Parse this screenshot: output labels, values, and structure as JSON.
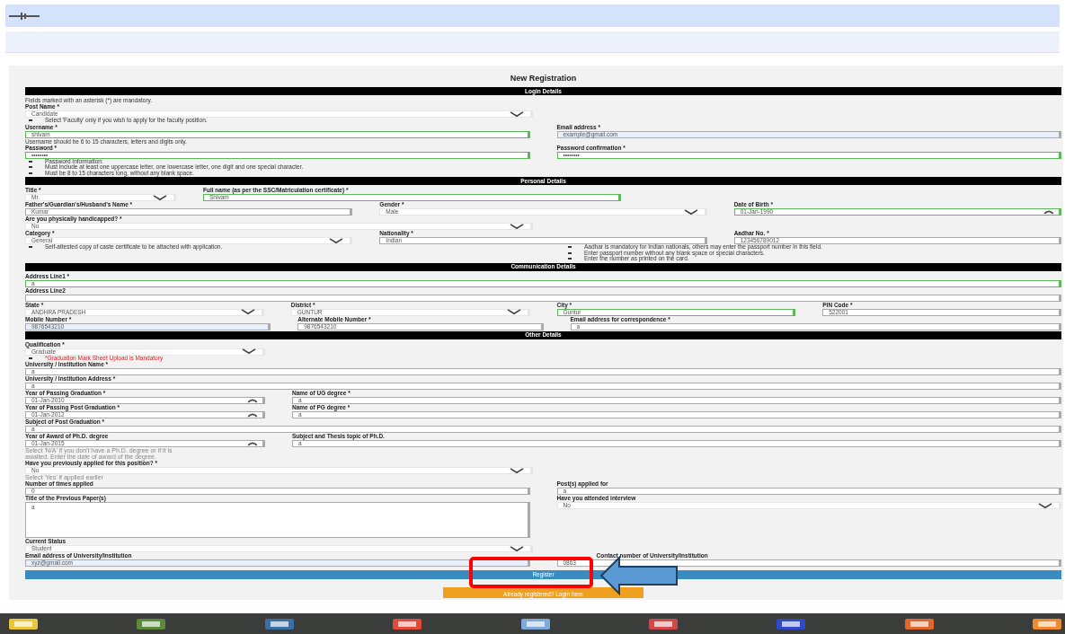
{
  "form": {
    "title": "New Registration",
    "sections": [
      {
        "title": "Login Details",
        "rows": [
          {
            "kind": "note",
            "text": "Fields marked with an asterisk (*) are mandatory."
          },
          {
            "kind": "half",
            "fields": [
              {
                "kind": "select",
                "label": "Post Name *",
                "value": "Candidate",
                "valid": false,
                "autofilled": false
              }
            ]
          },
          {
            "kind": "bullets",
            "items": [
              "Select 'Faculty' only if you wish to apply for the faculty position."
            ]
          },
          {
            "kind": "pair",
            "fields": [
              {
                "kind": "text",
                "label": "Username *",
                "value": "shivam",
                "valid": true,
                "autofilled": false
              },
              {
                "kind": "text",
                "label": "Email address *",
                "value": "example@gmail.com",
                "valid": false,
                "autofilled": true
              }
            ]
          },
          {
            "kind": "note",
            "text": "Username should be 6 to 15 characters, letters and digits only."
          },
          {
            "kind": "pair",
            "fields": [
              {
                "kind": "text",
                "label": "Password *",
                "value": "••••••••",
                "valid": true,
                "autofilled": false
              },
              {
                "kind": "text",
                "label": "Password confirmation *",
                "value": "••••••••",
                "valid": true,
                "autofilled": false
              }
            ]
          },
          {
            "kind": "bullets",
            "items": [
              "Password Information:",
              "Must include at least one uppercase letter, one lowercase letter, one digit and one special character.",
              "Must be 8 to 15 characters long, without any blank space."
            ]
          }
        ]
      },
      {
        "title": "Personal Details",
        "rows": [
          {
            "kind": "name",
            "fields": [
              {
                "kind": "select",
                "label": "Title *",
                "value": "Mr.",
                "valid": false,
                "autofilled": false
              },
              {
                "kind": "text",
                "label": "Full name (as per the SSC/Matriculation certificate) *",
                "value": "Shivam",
                "valid": true,
                "autofilled": false
              }
            ]
          },
          {
            "kind": "trio",
            "fields": [
              {
                "kind": "text",
                "label": "Father's/Guardian's/Husband's Name *",
                "value": "Kumar",
                "valid": false,
                "autofilled": false
              },
              {
                "kind": "select",
                "label": "Gender *",
                "value": "Male",
                "valid": false,
                "autofilled": false
              },
              {
                "kind": "date",
                "label": "Date of Birth *",
                "value": "01-Jan-1990",
                "valid": true,
                "autofilled": false
              }
            ]
          },
          {
            "kind": "half",
            "fields": [
              {
                "kind": "select",
                "label": "Are you physically handicapped? *",
                "value": "No",
                "valid": false,
                "autofilled": false
              }
            ]
          },
          {
            "kind": "trio",
            "fields": [
              {
                "kind": "select",
                "label": "Category *",
                "value": "General",
                "valid": false,
                "autofilled": false
              },
              {
                "kind": "text",
                "label": "Nationality *",
                "value": "Indian",
                "valid": false,
                "autofilled": false
              },
              {
                "kind": "text",
                "label": "Aadhar No. *",
                "value": "123456789012",
                "valid": false,
                "autofilled": false
              }
            ]
          },
          {
            "kind": "split",
            "left": [
              "Self-attested copy of caste certificate to be attached with application."
            ],
            "right": [
              "Aadhar is mandatory for Indian nationals, others may enter the passport number in this field.",
              "Enter passport number without any blank space or special characters.",
              "Enter the number as printed on the card."
            ]
          }
        ]
      },
      {
        "title": "Communication Details",
        "rows": [
          {
            "kind": "full",
            "fields": [
              {
                "kind": "text",
                "label": "Address Line1 *",
                "value": "a",
                "valid": true,
                "autofilled": false
              }
            ]
          },
          {
            "kind": "full",
            "fields": [
              {
                "kind": "text",
                "label": "Address Line2",
                "valid": false,
                "autofilled": false
              }
            ]
          },
          {
            "kind": "quad",
            "fields": [
              {
                "kind": "select",
                "label": "State *",
                "value": "ANDHRA PRADESH",
                "valid": false,
                "autofilled": false
              },
              {
                "kind": "select",
                "label": "District *",
                "value": "GUNTUR",
                "valid": false,
                "autofilled": false
              },
              {
                "kind": "text",
                "label": "City *",
                "value": "Guntur",
                "valid": true,
                "autofilled": false
              },
              {
                "kind": "text",
                "label": "PIN Code *",
                "value": "522001",
                "valid": false,
                "autofilled": false
              }
            ]
          },
          {
            "kind": "contact",
            "fields": [
              {
                "kind": "text",
                "label": "Mobile Number *",
                "value": "9876543210",
                "valid": false,
                "autofilled": true
              },
              {
                "kind": "text",
                "label": "Alternate Mobile Number *",
                "value": "9876543210",
                "valid": false,
                "autofilled": false
              },
              {
                "kind": "text",
                "label": "Email address for correspondence *",
                "value": "a",
                "valid": false,
                "autofilled": false
              }
            ]
          }
        ]
      },
      {
        "title": "Other Details",
        "rows": [
          {
            "kind": "narrow",
            "fields": [
              {
                "kind": "select",
                "label": "Qualification *",
                "value": "Graduate",
                "valid": false,
                "autofilled": false
              }
            ]
          },
          {
            "kind": "warning",
            "items": [
              "*Graduation Mark Sheet Upload is Mandatory"
            ]
          },
          {
            "kind": "full",
            "fields": [
              {
                "kind": "text",
                "label": "University / Institution Name *",
                "value": "a",
                "valid": false,
                "autofilled": false
              }
            ]
          },
          {
            "kind": "full",
            "fields": [
              {
                "kind": "text",
                "label": "University / Institution Address *",
                "value": "a",
                "valid": false,
                "autofilled": false
              }
            ]
          },
          {
            "kind": "narrow-wide",
            "fields": [
              {
                "kind": "date",
                "label": "Year of Passing Graduation *",
                "value": "01-Jan-2010",
                "valid": false,
                "autofilled": false
              },
              {
                "kind": "text",
                "label": "Name of UG degree *",
                "value": "a",
                "valid": false,
                "autofilled": false
              }
            ]
          },
          {
            "kind": "narrow-wide",
            "fields": [
              {
                "kind": "date",
                "label": "Year of Passing Post Graduation *",
                "value": "01-Jan-2012",
                "valid": false,
                "autofilled": false
              },
              {
                "kind": "text",
                "label": "Name of PG degree *",
                "value": "a",
                "valid": false,
                "autofilled": false
              }
            ]
          },
          {
            "kind": "full",
            "fields": [
              {
                "kind": "text",
                "label": "Subject of Post Graduation *",
                "value": "a",
                "valid": false,
                "autofilled": false
              }
            ]
          },
          {
            "kind": "narrow-wide",
            "fields": [
              {
                "kind": "date",
                "label": "Year of Award of Ph.D. degree",
                "value": "01-Jan-2015",
                "valid": false,
                "autofilled": false
              },
              {
                "kind": "text",
                "label": "Subject and Thesis topic of Ph.D.",
                "value": "a",
                "valid": false,
                "autofilled": false
              }
            ]
          },
          {
            "kind": "hint",
            "items": [
              "Select 'N/A' if you don't have a Ph.D. degree or if it is",
              "awaited. Enter the date of award of the degree."
            ]
          },
          {
            "kind": "half",
            "fields": [
              {
                "kind": "select",
                "label": "Have you previously applied for this position? *",
                "value": "No",
                "valid": false,
                "autofilled": false
              }
            ]
          },
          {
            "kind": "hint",
            "items": [
              "Select 'Yes' if applied earlier"
            ]
          },
          {
            "kind": "pair",
            "fields": [
              {
                "kind": "text",
                "label": "Number of times applied",
                "value": "0",
                "valid": false,
                "autofilled": false
              },
              {
                "kind": "text",
                "label": "Post(s) applied for",
                "value": "a",
                "valid": false,
                "autofilled": false
              }
            ]
          },
          {
            "kind": "pair",
            "fields": [
              {
                "kind": "textarea",
                "label": "Title of the Previous Paper(s)",
                "value": "a",
                "valid": false,
                "autofilled": false
              },
              {
                "kind": "select",
                "label": "Have you attended interview",
                "value": "No",
                "valid": false,
                "autofilled": false
              }
            ]
          },
          {
            "kind": "half",
            "fields": [
              {
                "kind": "select",
                "label": "Current Status",
                "value": "Student",
                "valid": false,
                "autofilled": false
              }
            ]
          },
          {
            "kind": "pair-offset",
            "fields": [
              {
                "kind": "text",
                "label": "Email address of University/Institution",
                "value": "xyz@gmail.com",
                "valid": false,
                "autofilled": true
              },
              {
                "kind": "text",
                "label": "Contact number of University/Institution",
                "value": "0863",
                "valid": false,
                "autofilled": false
              }
            ]
          }
        ]
      }
    ],
    "submit": "Register",
    "secondary": "Already registered? Login here"
  }
}
